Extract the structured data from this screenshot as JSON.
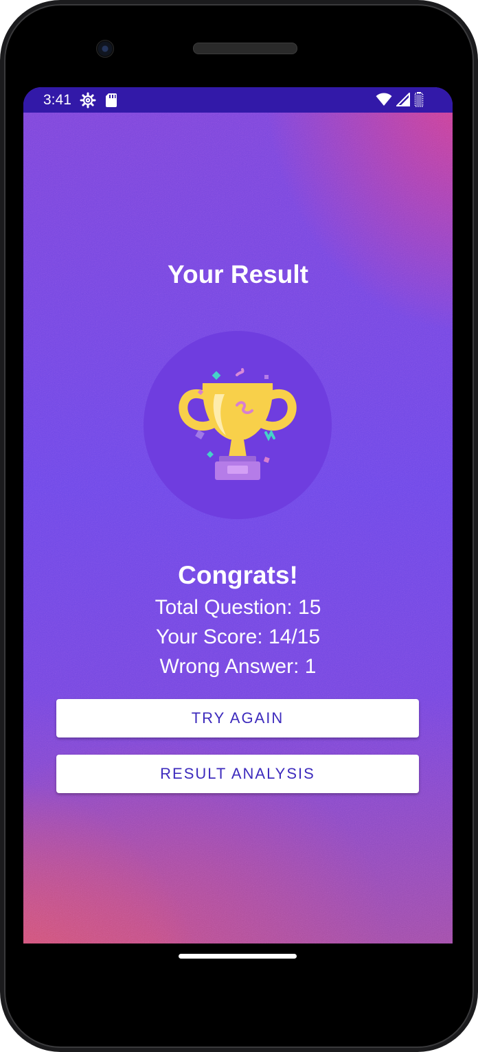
{
  "status_bar": {
    "time": "3:41",
    "left_icons": [
      "settings-gear-icon",
      "sd-card-icon"
    ],
    "right_icons": [
      "wifi-icon",
      "cell-signal-icon",
      "battery-icon"
    ],
    "color": "#3219a8"
  },
  "result": {
    "title": "Your Result",
    "congrats": "Congrats!",
    "total_question": "Total Question: 15",
    "your_score": "Your Score: 14/15",
    "wrong_answer": "Wrong Answer: 1",
    "image": "trophy-icon"
  },
  "buttons": {
    "try_again": "TRY AGAIN",
    "result_analysis": "RESULT ANALYSIS"
  },
  "colors": {
    "accent_text": "#3d2bbd",
    "circle": "#6f3ddf",
    "trophy": "#f8d04a",
    "trophy_base": "#b57ce8"
  }
}
